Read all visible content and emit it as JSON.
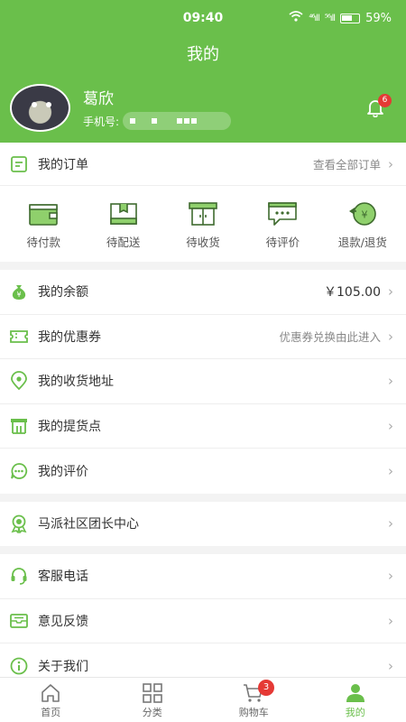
{
  "status_bar": {
    "time": "09:40",
    "signal1": "⁴⁶ıll",
    "signal2": "⁵⁶ıll",
    "battery": "59%"
  },
  "header": {
    "title": "我的"
  },
  "user": {
    "name": "葛欣",
    "phone_label": "手机号:"
  },
  "notifications": {
    "badge": "6"
  },
  "orders": {
    "title": "我的订单",
    "view_all": "查看全部订单",
    "items": [
      {
        "label": "待付款",
        "icon": "wallet-icon"
      },
      {
        "label": "待配送",
        "icon": "package-icon"
      },
      {
        "label": "待收货",
        "icon": "cabinet-icon"
      },
      {
        "label": "待评价",
        "icon": "comment-icon"
      },
      {
        "label": "退款/退货",
        "icon": "refund-icon"
      }
    ]
  },
  "account_menu": [
    {
      "label": "我的余额",
      "value": "￥105.00",
      "icon": "money-bag-icon"
    },
    {
      "label": "我的优惠券",
      "value": "优惠券兑换由此进入",
      "icon": "coupon-icon"
    },
    {
      "label": "我的收货地址",
      "value": "",
      "icon": "location-icon"
    },
    {
      "label": "我的提货点",
      "value": "",
      "icon": "store-icon"
    },
    {
      "label": "我的评价",
      "value": "",
      "icon": "chat-icon"
    }
  ],
  "community": {
    "label": "马派社区团长中心",
    "icon": "medal-icon"
  },
  "support_menu": [
    {
      "label": "客服电话",
      "icon": "headset-icon"
    },
    {
      "label": "意见反馈",
      "icon": "feedback-icon"
    },
    {
      "label": "关于我们",
      "icon": "info-icon"
    }
  ],
  "tabbar": {
    "items": [
      {
        "label": "首页",
        "icon": "home-icon"
      },
      {
        "label": "分类",
        "icon": "grid-icon"
      },
      {
        "label": "购物车",
        "icon": "cart-icon",
        "badge": "3"
      },
      {
        "label": "我的",
        "icon": "user-icon",
        "active": true
      }
    ]
  },
  "colors": {
    "accent": "#6abf4b",
    "badge": "#e53935"
  }
}
